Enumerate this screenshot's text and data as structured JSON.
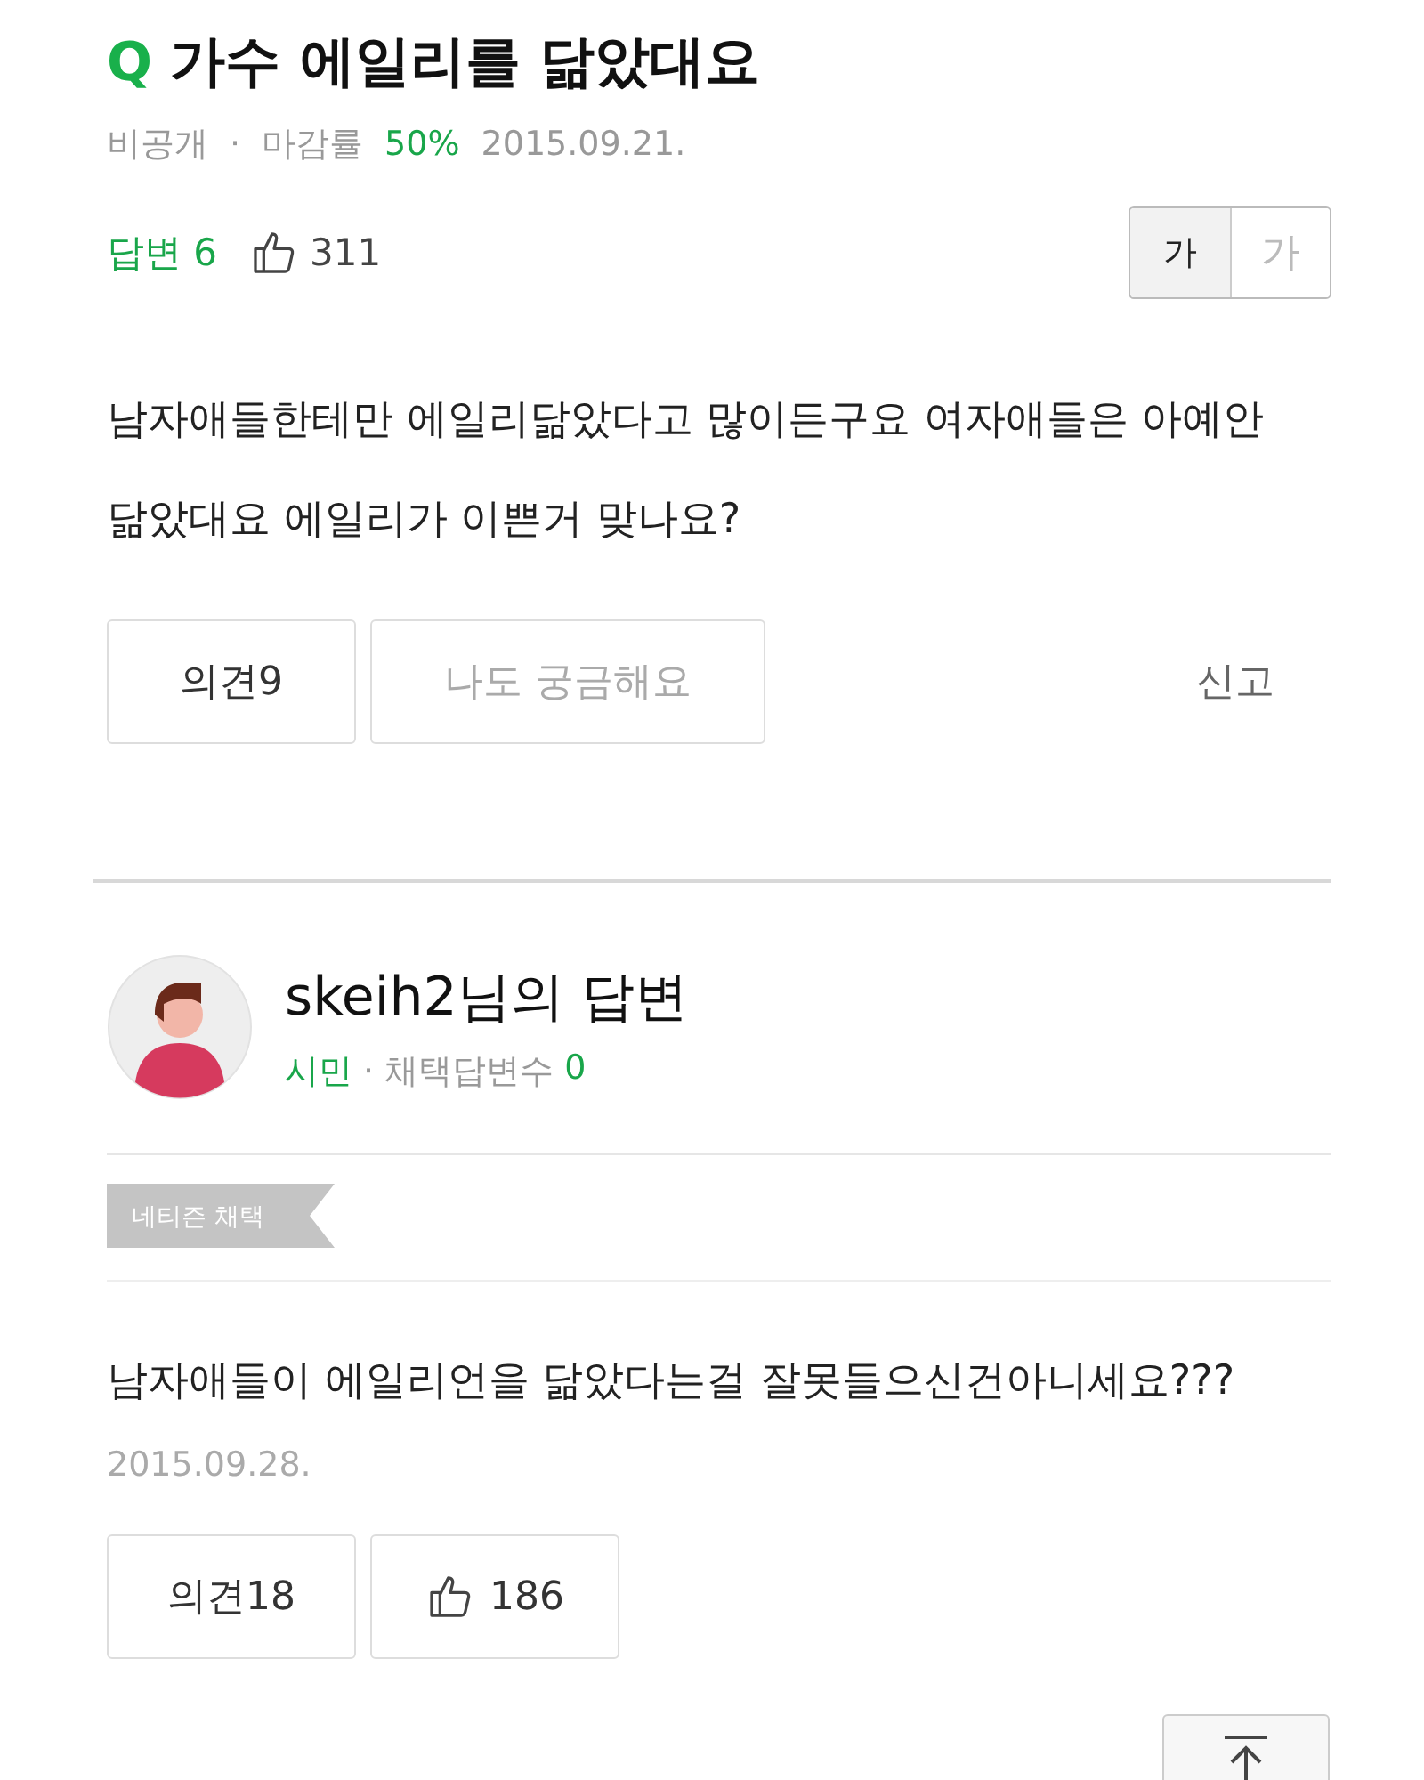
{
  "question": {
    "mark": "Q",
    "title": "가수 에일리를 닮았대요",
    "privacy": "비공개",
    "separator": "·",
    "close_rate_label": "마감률",
    "close_rate": "50%",
    "date": "2015.09.21.",
    "answers_label": "답변 6",
    "likes": "311",
    "font_sizes": [
      {
        "label": "가",
        "selected": true
      },
      {
        "label": "가",
        "selected": false
      }
    ],
    "body": "남자애들한테만 에일리닮았다고 많이든구요 여자애들은 아예안닮았대요 에일리가 이쁜거 맞나요?",
    "opinions_button": "의견9",
    "curious_button": "나도 궁금해요",
    "report": "신고"
  },
  "answer": {
    "title": "skeih2님의 답변",
    "rank": "시민",
    "stats": "· 채택답변수",
    "stats_count": "0",
    "tag": "네티즌 채택",
    "body": "남자애들이 에일리언을 닮았다는걸 잘못들으신건아니세요???",
    "date": "2015.09.28.",
    "opinions_button": "의견18",
    "likes": "186"
  }
}
